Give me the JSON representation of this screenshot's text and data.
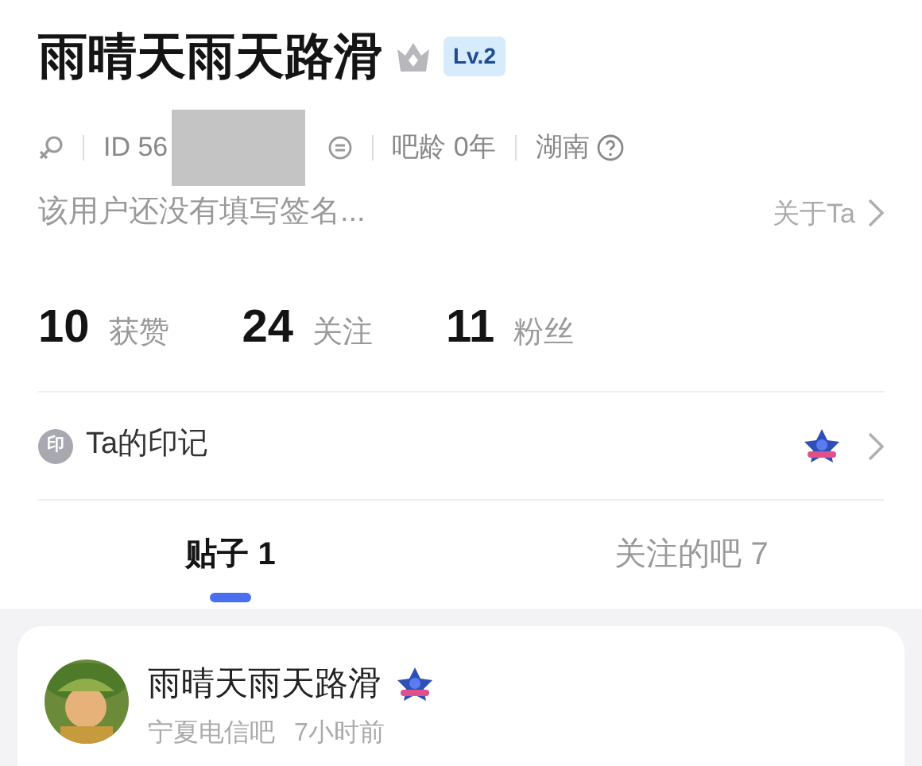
{
  "profile": {
    "name": "雨晴天雨天路滑",
    "level_badge": "Lv.2",
    "id_text": "ID 56",
    "age": "吧龄 0年",
    "location": "湖南",
    "signature": "该用户还没有填写签名...",
    "about_link": "关于Ta"
  },
  "stats": [
    {
      "value": "10",
      "label": "获赞"
    },
    {
      "value": "24",
      "label": "关注"
    },
    {
      "value": "11",
      "label": "粉丝"
    }
  ],
  "marks": {
    "icon_text": "印",
    "label": "Ta的印记"
  },
  "tabs": [
    {
      "label": "贴子 1",
      "selected": true
    },
    {
      "label": "关注的吧 7",
      "selected": false
    }
  ],
  "post": {
    "author": "雨晴天雨天路滑",
    "forum": "宁夏电信吧",
    "time": "7小时前"
  }
}
